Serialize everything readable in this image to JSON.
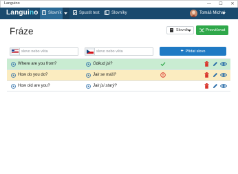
{
  "window": {
    "title": "Languino"
  },
  "navbar": {
    "logo_prefix": "Langui",
    "logo_o": "n",
    "logo_suffix": "o",
    "items": [
      {
        "label": "Slovník",
        "icon": "book-icon"
      },
      {
        "label": "Spustit test",
        "icon": "test-icon"
      },
      {
        "label": "Slovníky",
        "icon": "books-icon"
      }
    ],
    "user_name": "Tomáš Michal"
  },
  "page": {
    "title": "Fráze",
    "dictionary_label": "Slovník",
    "practice_label": "Procvičovat"
  },
  "add_form": {
    "source_placeholder": "slovo nebo věta",
    "target_placeholder": "slovo nebo věta",
    "add_label": "Přidat slovo"
  },
  "phrases": [
    {
      "en": "Where are you from?",
      "cz": "Odkud jsi?",
      "status": "correct"
    },
    {
      "en": "How do you do?",
      "cz": "Jak se máš?",
      "status": "wrong"
    },
    {
      "en": "How old are you?",
      "cz": "Jak jsi starý?",
      "status": "none"
    }
  ],
  "colors": {
    "navbar": "#1a4a6e",
    "accent_blue": "#1f7ac4",
    "practice_green": "#2fa84a",
    "correct_row": "#c9ecd2",
    "wrong_row": "#fbecc0",
    "delete_red": "#d9342b"
  }
}
